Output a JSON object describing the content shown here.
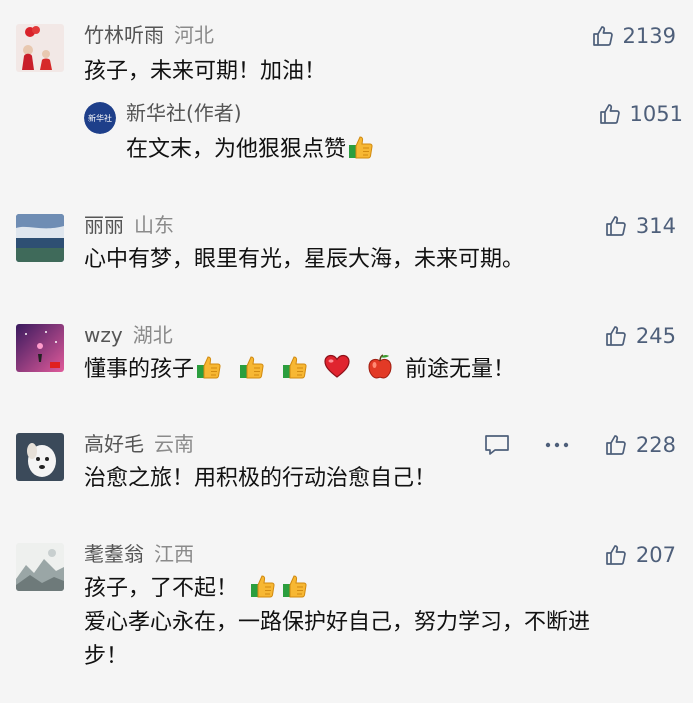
{
  "comments": [
    {
      "username": "竹林听雨",
      "location": "河北",
      "likes": "2139",
      "text": "孩子，未来可期！加油！",
      "reply": {
        "username": "新华社(作者)",
        "likes": "1051",
        "text_prefix": "在文末，为他狠狠点赞",
        "avatar_text": "新华社"
      }
    },
    {
      "username": "丽丽",
      "location": "山东",
      "likes": "314",
      "text": "心中有梦，眼里有光，星辰大海，未来可期。"
    },
    {
      "username": "wzy",
      "location": "湖北",
      "likes": "245",
      "text_prefix": "懂事的孩子",
      "text_suffix": "前途无量！"
    },
    {
      "username": "高好毛",
      "location": "云南",
      "likes": "228",
      "text": "治愈之旅！用积极的行动治愈自己！"
    },
    {
      "username": "耄耋翁",
      "location": "江西",
      "likes": "207",
      "line1": "孩子，了不起！",
      "line2": "爱心孝心永在，一路保护好自己，努力学习，不断进",
      "line3": "步！"
    }
  ],
  "icons": {
    "like": "thumbs-up-icon",
    "comment": "comment-icon",
    "more": "more-icon"
  },
  "colors": {
    "background": "#f5f5f5",
    "username": "#555555",
    "location": "#8a8a8a",
    "like_count": "#4e5f7a"
  }
}
